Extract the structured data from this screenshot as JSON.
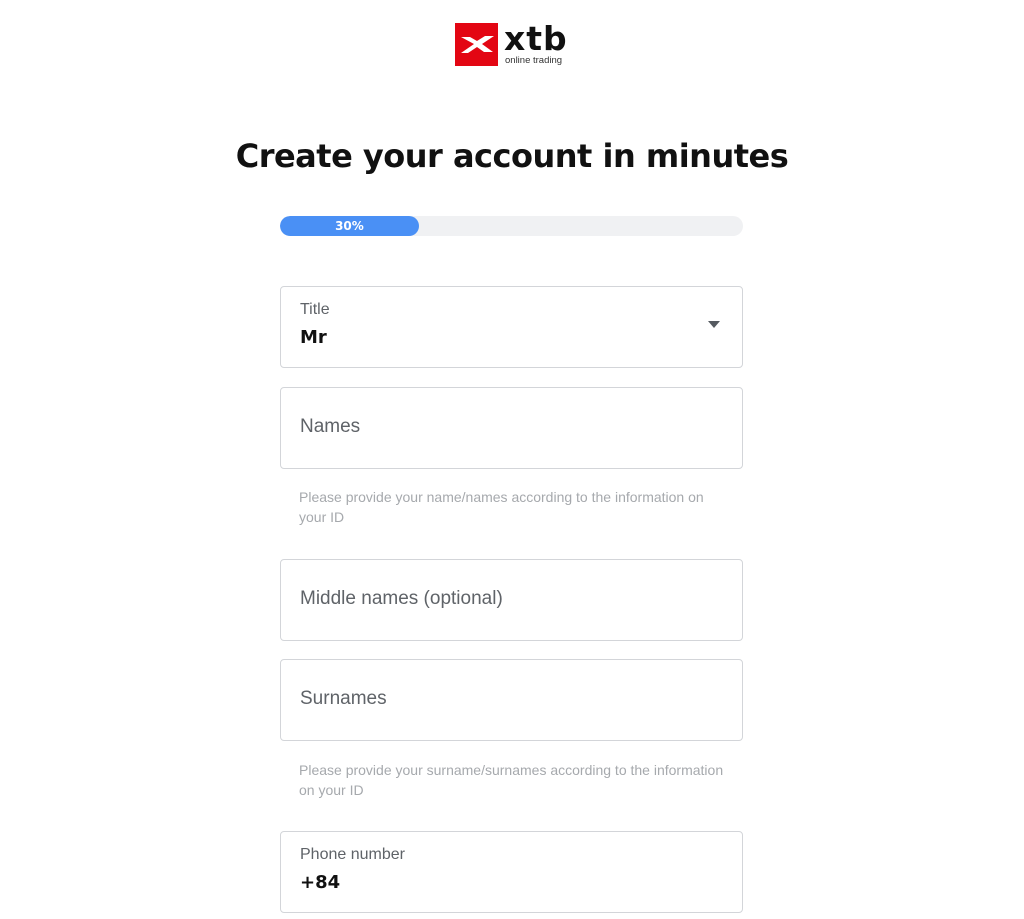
{
  "brand": {
    "name": "xtb",
    "tagline": "online trading",
    "color": "#e30613"
  },
  "heading": "Create your account in minutes",
  "progress": {
    "percent": 30,
    "label": "30%",
    "color": "#4a90f5"
  },
  "form": {
    "title_field": {
      "label": "Title",
      "value": "Mr",
      "icon": "chevron-down-icon"
    },
    "names_field": {
      "placeholder": "Names",
      "hint": "Please provide your name/names according to the information on your ID"
    },
    "middle_names_field": {
      "placeholder": "Middle names (optional)"
    },
    "surnames_field": {
      "placeholder": "Surnames",
      "hint": "Please provide your surname/surnames according to the information on your ID"
    },
    "phone_field": {
      "label": "Phone number",
      "value": "+84"
    }
  }
}
